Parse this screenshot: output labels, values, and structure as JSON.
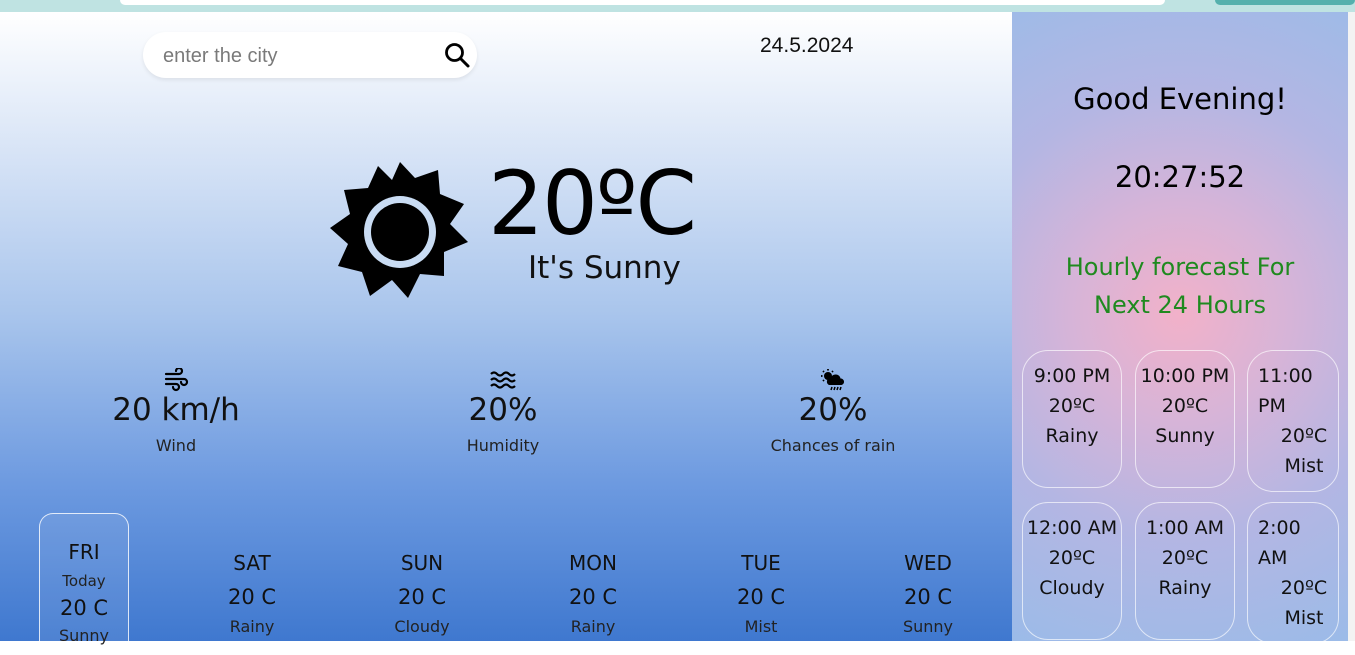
{
  "search": {
    "placeholder": "enter the city"
  },
  "date": "24.5.2024",
  "current": {
    "temperature": "20ºC",
    "condition": "It's Sunny"
  },
  "stats": [
    {
      "value": "20 km/h",
      "label": "Wind",
      "icon": "wind-icon"
    },
    {
      "value": "20%",
      "label": "Humidity",
      "icon": "humidity-icon"
    },
    {
      "value": "20%",
      "label": "Chances of rain",
      "icon": "rain-cloud-icon"
    }
  ],
  "daily": [
    {
      "day": "FRI",
      "sub": "Today",
      "temp": "20 C",
      "cond": "Sunny"
    },
    {
      "day": "SAT",
      "temp": "20 C",
      "cond": "Rainy"
    },
    {
      "day": "SUN",
      "temp": "20 C",
      "cond": "Cloudy"
    },
    {
      "day": "MON",
      "temp": "20 C",
      "cond": "Rainy"
    },
    {
      "day": "TUE",
      "temp": "20 C",
      "cond": "Mist"
    },
    {
      "day": "WED",
      "temp": "20 C",
      "cond": "Sunny"
    }
  ],
  "side": {
    "greeting": "Good Evening!",
    "clock": "20:27:52",
    "hourly_title_line1": "Hourly forecast For",
    "hourly_title_line2": "Next 24 Hours",
    "hourly": [
      {
        "time": "9:00 PM",
        "temp": "20ºC",
        "cond": "Rainy"
      },
      {
        "time": "10:00 PM",
        "temp": "20ºC",
        "cond": "Sunny"
      },
      {
        "time_a": "11:00",
        "time_b": "PM",
        "temp": "20ºC",
        "cond": "Mist"
      },
      {
        "time": "12:00 AM",
        "temp": "20ºC",
        "cond": "Cloudy"
      },
      {
        "time": "1:00 AM",
        "temp": "20ºC",
        "cond": "Rainy"
      },
      {
        "time_a": "2:00",
        "time_b": "AM",
        "temp": "20ºC",
        "cond": "Mist"
      }
    ]
  },
  "colors": {
    "hourly_title": "#1f8a1f",
    "main_gradient_bottom": "#3f78cf",
    "side_center": "#f2b1c9"
  }
}
